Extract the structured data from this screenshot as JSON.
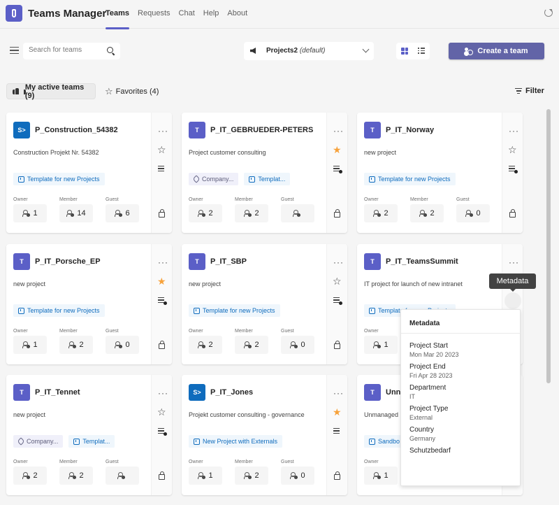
{
  "app": {
    "title": "Teams Manager"
  },
  "nav": {
    "items": [
      {
        "label": "Teams",
        "active": true
      },
      {
        "label": "Requests",
        "active": false
      },
      {
        "label": "Chat",
        "active": false
      },
      {
        "label": "Help",
        "active": false
      },
      {
        "label": "About",
        "active": false
      }
    ]
  },
  "toolbar": {
    "search_placeholder": "Search for teams",
    "project_select": {
      "value": "Projects2",
      "suffix": "(default)"
    },
    "view_mode": "grid",
    "create_label": "Create a team"
  },
  "tabs": {
    "active": {
      "label": "My active teams (9)"
    },
    "favorites": {
      "label": "Favorites (4)"
    },
    "filter_label": "Filter"
  },
  "stat_labels": {
    "owner": "Owner",
    "member": "Member",
    "guest": "Guest"
  },
  "colors": {
    "accent": "#5b5fc7",
    "button": "#6264a7",
    "favorite": "#f7a23b",
    "template_chip": "#0f6cbd"
  },
  "teams": [
    {
      "name": "P_Construction_54382",
      "type": "sharepoint",
      "logo": "S>",
      "description": "Construction Projekt Nr. 54382",
      "tags": [
        {
          "kind": "template",
          "label": "Template for new Projects"
        }
      ],
      "owner": "1",
      "member": "14",
      "guest": "6",
      "favorite": false,
      "metadata_checked": false
    },
    {
      "name": "P_IT_GEBRUEDER-PETERS",
      "type": "teams",
      "logo": "T",
      "description": "Project customer consulting",
      "tags": [
        {
          "kind": "company",
          "label": "Company..."
        },
        {
          "kind": "template",
          "label": "Templat..."
        }
      ],
      "owner": "2",
      "member": "2",
      "guest": "",
      "favorite": true,
      "metadata_checked": true
    },
    {
      "name": "P_IT_Norway",
      "type": "teams",
      "logo": "T",
      "description": "new project",
      "tags": [
        {
          "kind": "template",
          "label": "Template for new Projects"
        }
      ],
      "owner": "2",
      "member": "2",
      "guest": "0",
      "favorite": false,
      "metadata_checked": true
    },
    {
      "name": "P_IT_Porsche_EP",
      "type": "teams",
      "logo": "T",
      "description": "new project",
      "tags": [
        {
          "kind": "template",
          "label": "Template for new Projects"
        }
      ],
      "owner": "1",
      "member": "2",
      "guest": "0",
      "favorite": true,
      "metadata_checked": true
    },
    {
      "name": "P_IT_SBP",
      "type": "teams",
      "logo": "T",
      "description": "new project",
      "tags": [
        {
          "kind": "template",
          "label": "Template for new Projects"
        }
      ],
      "owner": "2",
      "member": "2",
      "guest": "0",
      "favorite": false,
      "metadata_checked": true
    },
    {
      "name": "P_IT_TeamsSummit",
      "type": "teams",
      "logo": "T",
      "description": "IT project for launch of new intranet",
      "tags": [
        {
          "kind": "template",
          "label": "Template for new Projects"
        }
      ],
      "owner": "1",
      "member": "",
      "guest": "",
      "favorite": false,
      "metadata_checked": true
    },
    {
      "name": "P_IT_Tennet",
      "type": "teams",
      "logo": "T",
      "description": "new project",
      "tags": [
        {
          "kind": "company",
          "label": "Company..."
        },
        {
          "kind": "template",
          "label": "Templat..."
        }
      ],
      "owner": "2",
      "member": "2",
      "guest": "",
      "favorite": false,
      "metadata_checked": true
    },
    {
      "name": "P_IT_Jones",
      "type": "sharepoint",
      "logo": "S>",
      "description": "Projekt customer consulting - governance",
      "tags": [
        {
          "kind": "template",
          "label": "New Project with Externals"
        }
      ],
      "owner": "1",
      "member": "2",
      "guest": "0",
      "favorite": true,
      "metadata_checked": false
    },
    {
      "name": "Unn",
      "type": "teams",
      "logo": "T",
      "description": "Unmanaged",
      "tags": [
        {
          "kind": "template",
          "label": "Sandbo"
        }
      ],
      "owner": "1",
      "member": "",
      "guest": "",
      "favorite": false,
      "metadata_checked": false
    }
  ],
  "tooltip": {
    "label": "Metadata"
  },
  "metadata_popover": {
    "title": "Metadata",
    "fields": [
      {
        "key": "Project Start",
        "value": "Mon Mar 20 2023"
      },
      {
        "key": "Project End",
        "value": "Fri Apr 28 2023"
      },
      {
        "key": "Department",
        "value": "IT"
      },
      {
        "key": "Project Type",
        "value": "External"
      },
      {
        "key": "Country",
        "value": "Germany"
      },
      {
        "key": "Schutzbedarf",
        "value": ""
      }
    ]
  }
}
